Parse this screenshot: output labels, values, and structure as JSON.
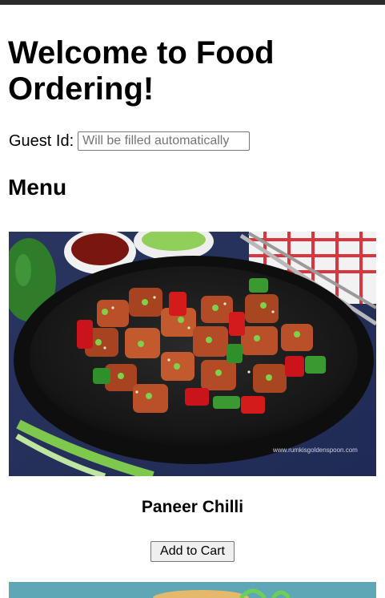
{
  "page": {
    "title": "Welcome to Food Ordering!"
  },
  "guest": {
    "label": "Guest Id:",
    "placeholder": "Will be filled automatically",
    "value": ""
  },
  "menu": {
    "heading": "Menu",
    "items": [
      {
        "name": "Paneer Chilli",
        "image_watermark": "www.rumkisgoldenspoon.com",
        "add_button_label": "Add to Cart"
      }
    ]
  }
}
